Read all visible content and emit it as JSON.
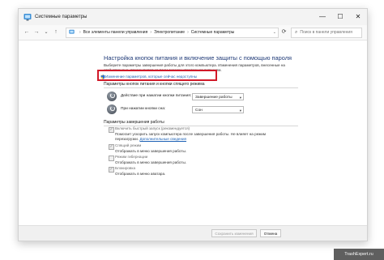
{
  "window": {
    "title": "Системные параметры",
    "minimize": "—",
    "maximize": "☐",
    "close": "✕"
  },
  "nav": {
    "back": "←",
    "forward": "→",
    "recent": "⌄",
    "up": "↑",
    "breadcrumb": [
      "Все элементы панели управления",
      "Электропитание",
      "Системные параметры"
    ],
    "separator": "›",
    "address_dropdown": "⌄",
    "refresh": "⟳",
    "search_placeholder": "Поиск в панели управления"
  },
  "page": {
    "heading": "Настройка кнопок питания и включение защиты с помощью пароля",
    "description_line1": "Выберите параметры завершения работы для этого компьютера. Изменения параметров, внесенные на",
    "description_line2": "этой странице, применяются ко всем схемам управления питанием.",
    "change_link": "Изменение параметров, которые сейчас недоступны"
  },
  "power_section": {
    "title": "Параметры кнопок питания и кнопки спящего режима",
    "rows": [
      {
        "label": "Действие при нажатии кнопки питания:",
        "value": "Завершение работы"
      },
      {
        "label": "При нажатии кнопки сна:",
        "value": "Сон"
      }
    ]
  },
  "shutdown_section": {
    "title": "Параметры завершения работы",
    "options": [
      {
        "label": "Включить быстрый запуск (рекомендуется)",
        "checked": true,
        "desc1": "Помогает ускорить запуск компьютера после завершения работы. Не влияет на режим",
        "desc2_prefix": "перезагрузки.",
        "desc2_link": "Дополнительные сведения"
      },
      {
        "label": "Спящий режим",
        "checked": true,
        "desc1": "Отображать в меню завершения работы."
      },
      {
        "label": "Режим гибернации",
        "checked": false,
        "desc1": "Отображать в меню завершения работы."
      },
      {
        "label": "Блокировка",
        "checked": true,
        "desc1": "Отображать в меню аватара."
      }
    ]
  },
  "footer": {
    "save": "Сохранить изменения",
    "cancel": "Отмена"
  },
  "watermark": "TrashExpert.ru",
  "colors": {
    "highlight": "#d11a2a",
    "link": "#1a5fb4",
    "heading": "#1f3a77"
  }
}
